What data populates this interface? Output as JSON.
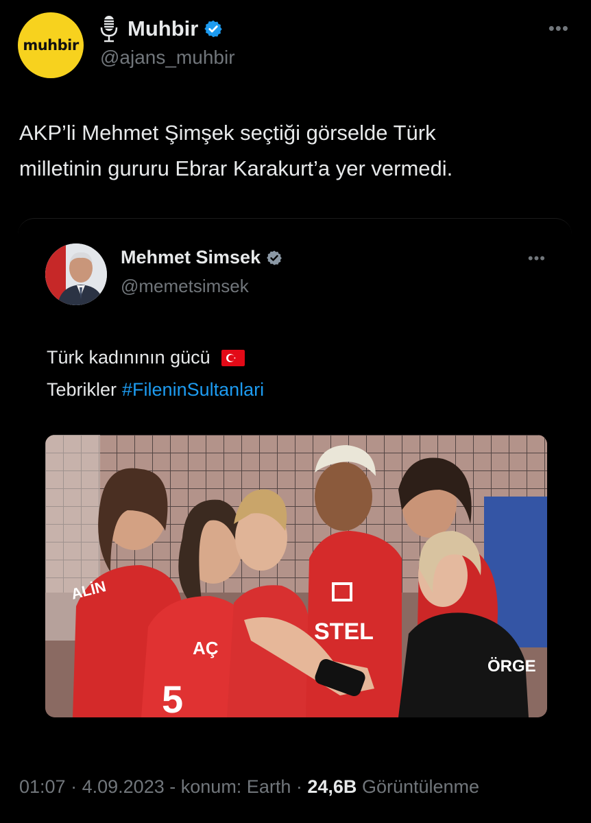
{
  "author": {
    "avatar_text": "muhbir",
    "display_name": "Muhbir",
    "handle": "@ajans_muhbir",
    "verified": true
  },
  "tweet": {
    "text_line1": "AKP’li Mehmet Şimşek seçtiği görselde Türk",
    "text_line2": "milletinin gururu Ebrar Karakurt’a yer vermedi."
  },
  "quoted": {
    "display_name": "Mehmet Simsek",
    "handle": "@memetsimsek",
    "verified": true,
    "text_line1": "Türk kadınının gücü",
    "text_line2_prefix": "Tebrikler",
    "hashtag": "#FileninSultanlari",
    "flag_icon": "turkey-flag-icon",
    "jersey_texts": [
      "STEL",
      "AÇ",
      "5",
      "ÖRGE",
      "ALİN"
    ]
  },
  "footer": {
    "time": "01:07",
    "date": "4.09.2023",
    "location": "konum: Earth",
    "views_count": "24,6B",
    "views_label": "Görüntülenme",
    "sep_dot": "·",
    "sep_dash": "-"
  },
  "colors": {
    "background": "#000000",
    "text": "#e7e9ea",
    "muted": "#71767b",
    "link": "#1d9bf0",
    "verified": "#1d9bf0",
    "avatar_bg": "#f7d21e"
  }
}
